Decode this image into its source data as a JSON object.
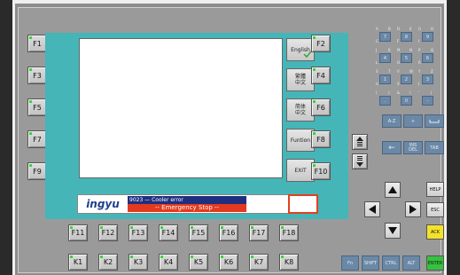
{
  "left_function_keys": [
    "F1",
    "F3",
    "F5",
    "F7",
    "F9"
  ],
  "right_function_keys": [
    "F2",
    "F4",
    "F6",
    "F8",
    "F10"
  ],
  "side_buttons": [
    {
      "label": "English"
    },
    {
      "label": "繁體\n中文"
    },
    {
      "label": "简体\n中文"
    },
    {
      "label": "Funtion"
    },
    {
      "label": "EXIT"
    }
  ],
  "status": {
    "logo": "ingyu",
    "alarm_message": "9023 — Cooler error",
    "emergency_message": "--  Emergency Stop  --"
  },
  "bottom_f_keys": [
    "F11",
    "F12",
    "F13",
    "F14",
    "F15",
    "F16",
    "F17",
    "F18"
  ],
  "k_keys": [
    "K1",
    "K2",
    "K3",
    "K4",
    "K5",
    "K6",
    "K7",
    "K8"
  ],
  "keypad": {
    "keys": [
      {
        "main": "7",
        "tl": "A",
        "tr": "B",
        "bl": "C"
      },
      {
        "main": "8",
        "tl": "D",
        "tr": "E",
        "bl": "F"
      },
      {
        "main": "9",
        "tl": "G",
        "tr": "H",
        "bl": "I"
      },
      {
        "main": "4",
        "tl": "J",
        "tr": "K",
        "bl": "L"
      },
      {
        "main": "5",
        "tl": "M",
        "tr": "N",
        "bl": "O"
      },
      {
        "main": "6",
        "tl": "P",
        "tr": "Q",
        "bl": "R"
      },
      {
        "main": "1",
        "tl": "S",
        "tr": "T",
        "bl": "U"
      },
      {
        "main": "2",
        "tl": "V",
        "tr": "W",
        "bl": "X"
      },
      {
        "main": "3",
        "tl": "Y",
        "tr": "Z",
        "bl": "["
      },
      {
        "main": ".",
        "tl": "(",
        "tr": ")",
        "bl": ""
      },
      {
        "main": "0",
        "tl": "&",
        "tr": "\\",
        "bl": ""
      },
      {
        "main": "-",
        "tl": "'",
        "tr": "|",
        "bl": ""
      }
    ],
    "az_label": "A-Z",
    "plus_label": "+",
    "space_label": "",
    "backspace_label": "←",
    "ins_label": "INS\nDEL",
    "tab_label": "TAB"
  },
  "nav": {
    "help_label": "HELP",
    "esc_label": "ESC",
    "ack_label": "ACK",
    "fn_label": "Fn",
    "shift_label": "SHIFT",
    "ctrl_label": "CTRL",
    "alt_label": "ALT",
    "enter_label": "ENTER",
    "ack_color": "#f4e22a",
    "enter_color": "#37c13f"
  },
  "colors": {
    "teal": "#45b5b8",
    "keypad_blue": "#6b89a6",
    "alarm_blue": "#1f2f80",
    "alarm_red": "#e23a1e",
    "led_green": "#3ad33a"
  }
}
